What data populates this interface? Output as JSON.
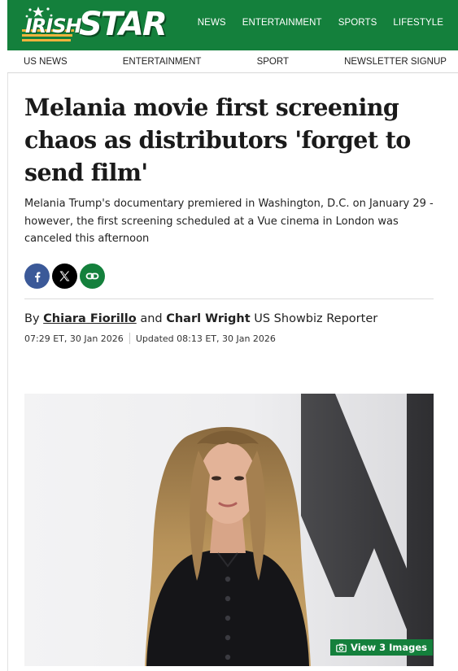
{
  "brand": {
    "logo_part1": "IRISH",
    "logo_part2": "STAR",
    "primary_color": "#14803c"
  },
  "top_nav": [
    "NEWS",
    "ENTERTAINMENT",
    "SPORTS",
    "LIFESTYLE"
  ],
  "sub_nav": [
    "US NEWS",
    "ENTERTAINMENT",
    "SPORT",
    "NEWSLETTER SIGNUP"
  ],
  "article": {
    "headline": "Melania movie first screening chaos as distributors 'forget to send film'",
    "standfirst": "Melania Trump's documentary premiered in Washington, D.C. on January 29 - however, the first screening scheduled at a Vue cinema in London was canceled this afternoon",
    "share_icons": [
      "facebook-icon",
      "x-icon",
      "link-icon"
    ],
    "byline": {
      "prefix": "By ",
      "author1": "Chiara Fiorillo",
      "joiner": " and ",
      "author2": "Charl Wright",
      "role": " US Showbiz Reporter"
    },
    "published": "07:29 ET, 30 Jan 2026",
    "updated": "Updated 08:13 ET, 30 Jan 2026"
  },
  "hero": {
    "view_images_label": "View 3 Images",
    "icon": "camera-icon"
  }
}
